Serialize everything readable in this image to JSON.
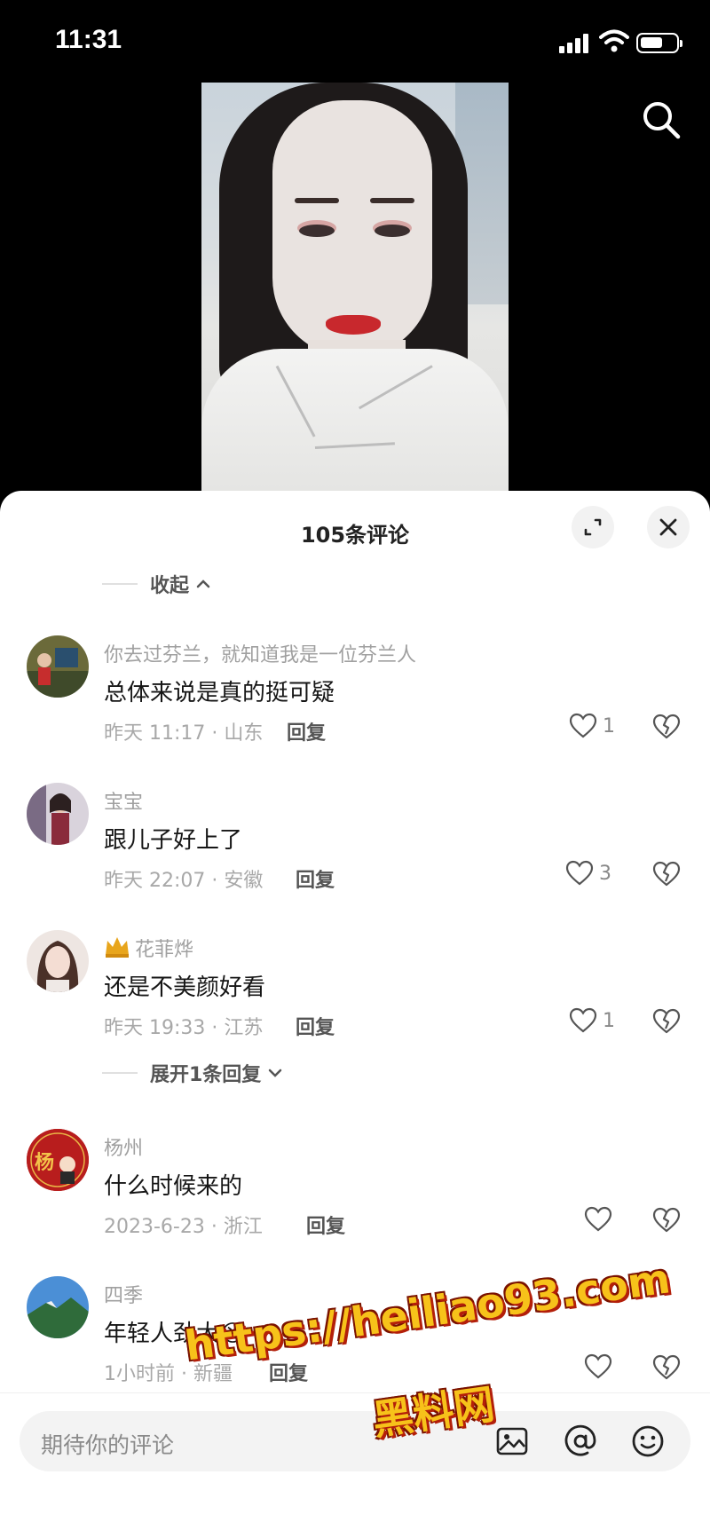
{
  "status_bar": {
    "time": "11:31"
  },
  "panel": {
    "title": "105条评论",
    "collapse_label": "收起",
    "expand_label": "展开1条回复"
  },
  "comments": [
    {
      "name": "你去过芬兰，就知道我是一位芬兰人",
      "text": "总体来说是真的挺可疑",
      "meta": "昨天 11:17 · 山东",
      "reply": "回复",
      "likes": "1"
    },
    {
      "name": "宝宝",
      "text": "跟儿子好上了",
      "meta": "昨天 22:07 · 安徽",
      "reply": "回复",
      "likes": "3"
    },
    {
      "name": "花菲烨",
      "text": "还是不美颜好看",
      "meta": "昨天 19:33 · 江苏",
      "reply": "回复",
      "likes": "1"
    },
    {
      "name": "杨州",
      "text": "什么时候来的",
      "meta": "2023-6-23 · 浙江",
      "reply": "回复",
      "likes": ""
    },
    {
      "name": "四季",
      "text": "年轻人劲大😭",
      "meta": "1小时前 · 新疆",
      "reply": "回复",
      "likes": ""
    }
  ],
  "avatar_labels": {
    "yang": "杨"
  },
  "input": {
    "placeholder": "期待你的评论"
  },
  "watermark": {
    "line1": "https://heiliao93.com",
    "line2": "黑料网"
  },
  "colors": {
    "accent_gold": "#f7c21a",
    "watermark_red": "#b31f0a",
    "crown": "#e8a51c"
  }
}
